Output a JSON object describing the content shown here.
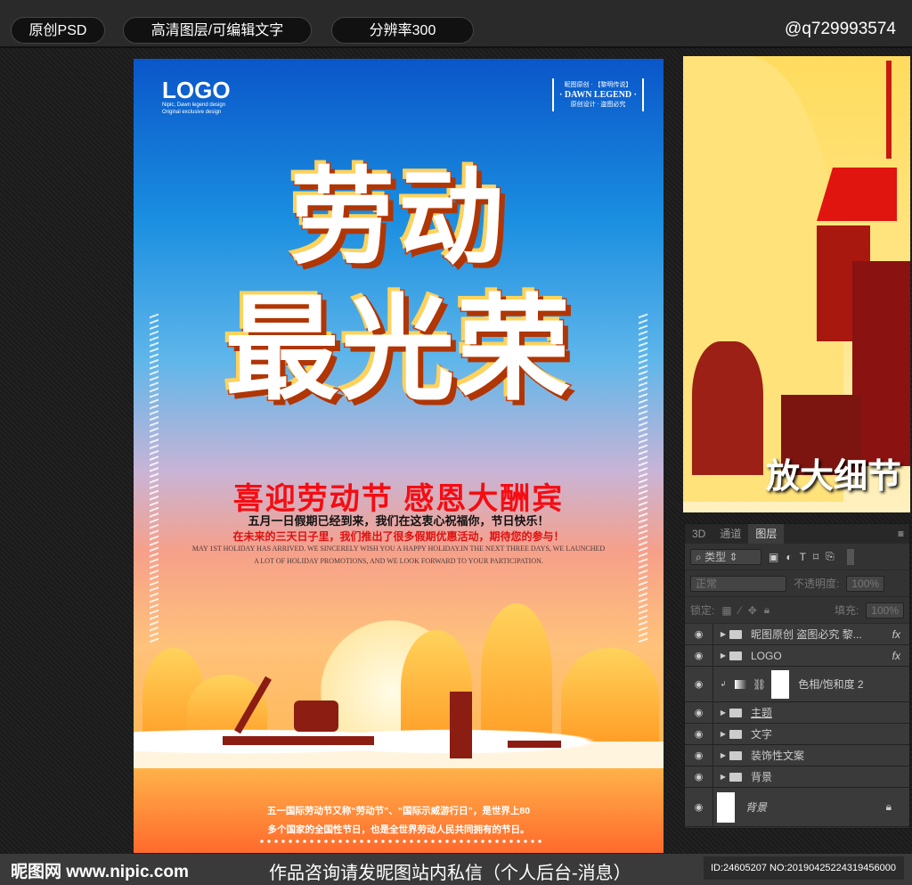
{
  "topbar": {
    "buttons": [
      "原创PSD",
      "高清图层/可编辑文字",
      "分辨率300"
    ],
    "handle": "@q729993574"
  },
  "poster": {
    "logo": "LOGO",
    "logo_sub1": "Nipic, Dawn legend design",
    "logo_sub2": "Original exclusive design",
    "dawn_top": "昵图原创 · 【黎明传说】",
    "dawn_main": "· DAWN LEGEND ·",
    "dawn_bottom": "原创设计 · 盗图必究",
    "title_line1": "劳动",
    "title_line2": "最光荣",
    "slogan": "喜迎劳动节 感恩大酬宾",
    "line1": "五月一日假期已经到来，我们在这衷心祝福你，节日快乐！",
    "line2": "在未来的三天日子里，我们推出了很多假期优惠活动，期待您的参与！",
    "line3": "MAY 1ST HOLIDAY HAS ARRIVED. WE SINCERELY WISH YOU A HAPPY HOLIDAY.IN THE NEXT THREE DAYS, WE LAUNCHED",
    "line4": "A LOT OF HOLIDAY PROMOTIONS, AND WE LOOK FORWARD TO YOUR PARTICIPATION.",
    "bottom1": "五一国际劳动节又称“劳动节”、“国际示威游行日”，是世界上80",
    "bottom2": "多个国家的全国性节日，也是全世界劳动人民共同拥有的节日。"
  },
  "detail": {
    "label": "放大细节"
  },
  "layers_panel": {
    "tabs": [
      "3D",
      "通道",
      "图层"
    ],
    "filter": "类型",
    "blend_mode": "正常",
    "opacity_label": "不透明度:",
    "opacity": "100%",
    "lock_label": "锁定:",
    "fill_label": "填充:",
    "fill": "100%",
    "layers": [
      {
        "name": "昵图原创 盗图必究 黎...",
        "type": "group",
        "fx": "fx"
      },
      {
        "name": "LOGO",
        "type": "group",
        "fx": "fx"
      },
      {
        "name": "色相/饱和度 2",
        "type": "adjustment"
      },
      {
        "name": "主题",
        "type": "group"
      },
      {
        "name": "文字",
        "type": "group"
      },
      {
        "name": "装饰性文案",
        "type": "group"
      },
      {
        "name": "背景",
        "type": "group"
      },
      {
        "name": "背景",
        "type": "background"
      }
    ]
  },
  "bottombar": {
    "site": "昵图网 www.nipic.com",
    "message": "作品咨询请发昵图站内私信（个人后台-消息）",
    "id": "ID:24605207 NO:20190425224319456000"
  }
}
